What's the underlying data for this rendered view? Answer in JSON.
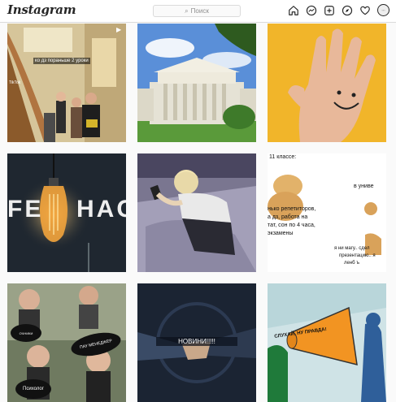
{
  "header": {
    "logo": "Instagram",
    "search_placeholder": "Поиск",
    "icons": [
      "home-icon",
      "messenger-icon",
      "new-post-icon",
      "explore-icon",
      "heart-icon",
      "profile-avatar"
    ]
  },
  "posts": {
    "p1": {
      "overlay_text": "ко дз пораньше 2 уроки",
      "badge": "TikTok"
    },
    "p2": {},
    "p3": {},
    "p4": {
      "text_left": "FE",
      "text_right": "HAC"
    },
    "p5": {},
    "p6": {
      "top": "11 классе:",
      "top_right": "в униве",
      "left_lines": [
        "нько репетиторов,",
        "а дз, работа на",
        "тат, сон по 4 часа,",
        "экзамены"
      ],
      "right_lines": [
        "я ни магу.. сдел",
        "презентацию.. я",
        "ленб ъ"
      ]
    },
    "p7": {
      "label1": "ОЧНИКИ",
      "label2": "ПАУ МЕНЕДЖЕР",
      "label3": "Психолог"
    },
    "p8": {
      "label": "НОВИНИ!!!!!"
    },
    "p9": {
      "label": "СЛУХАЙ, НУ ПРАВДА!"
    }
  }
}
